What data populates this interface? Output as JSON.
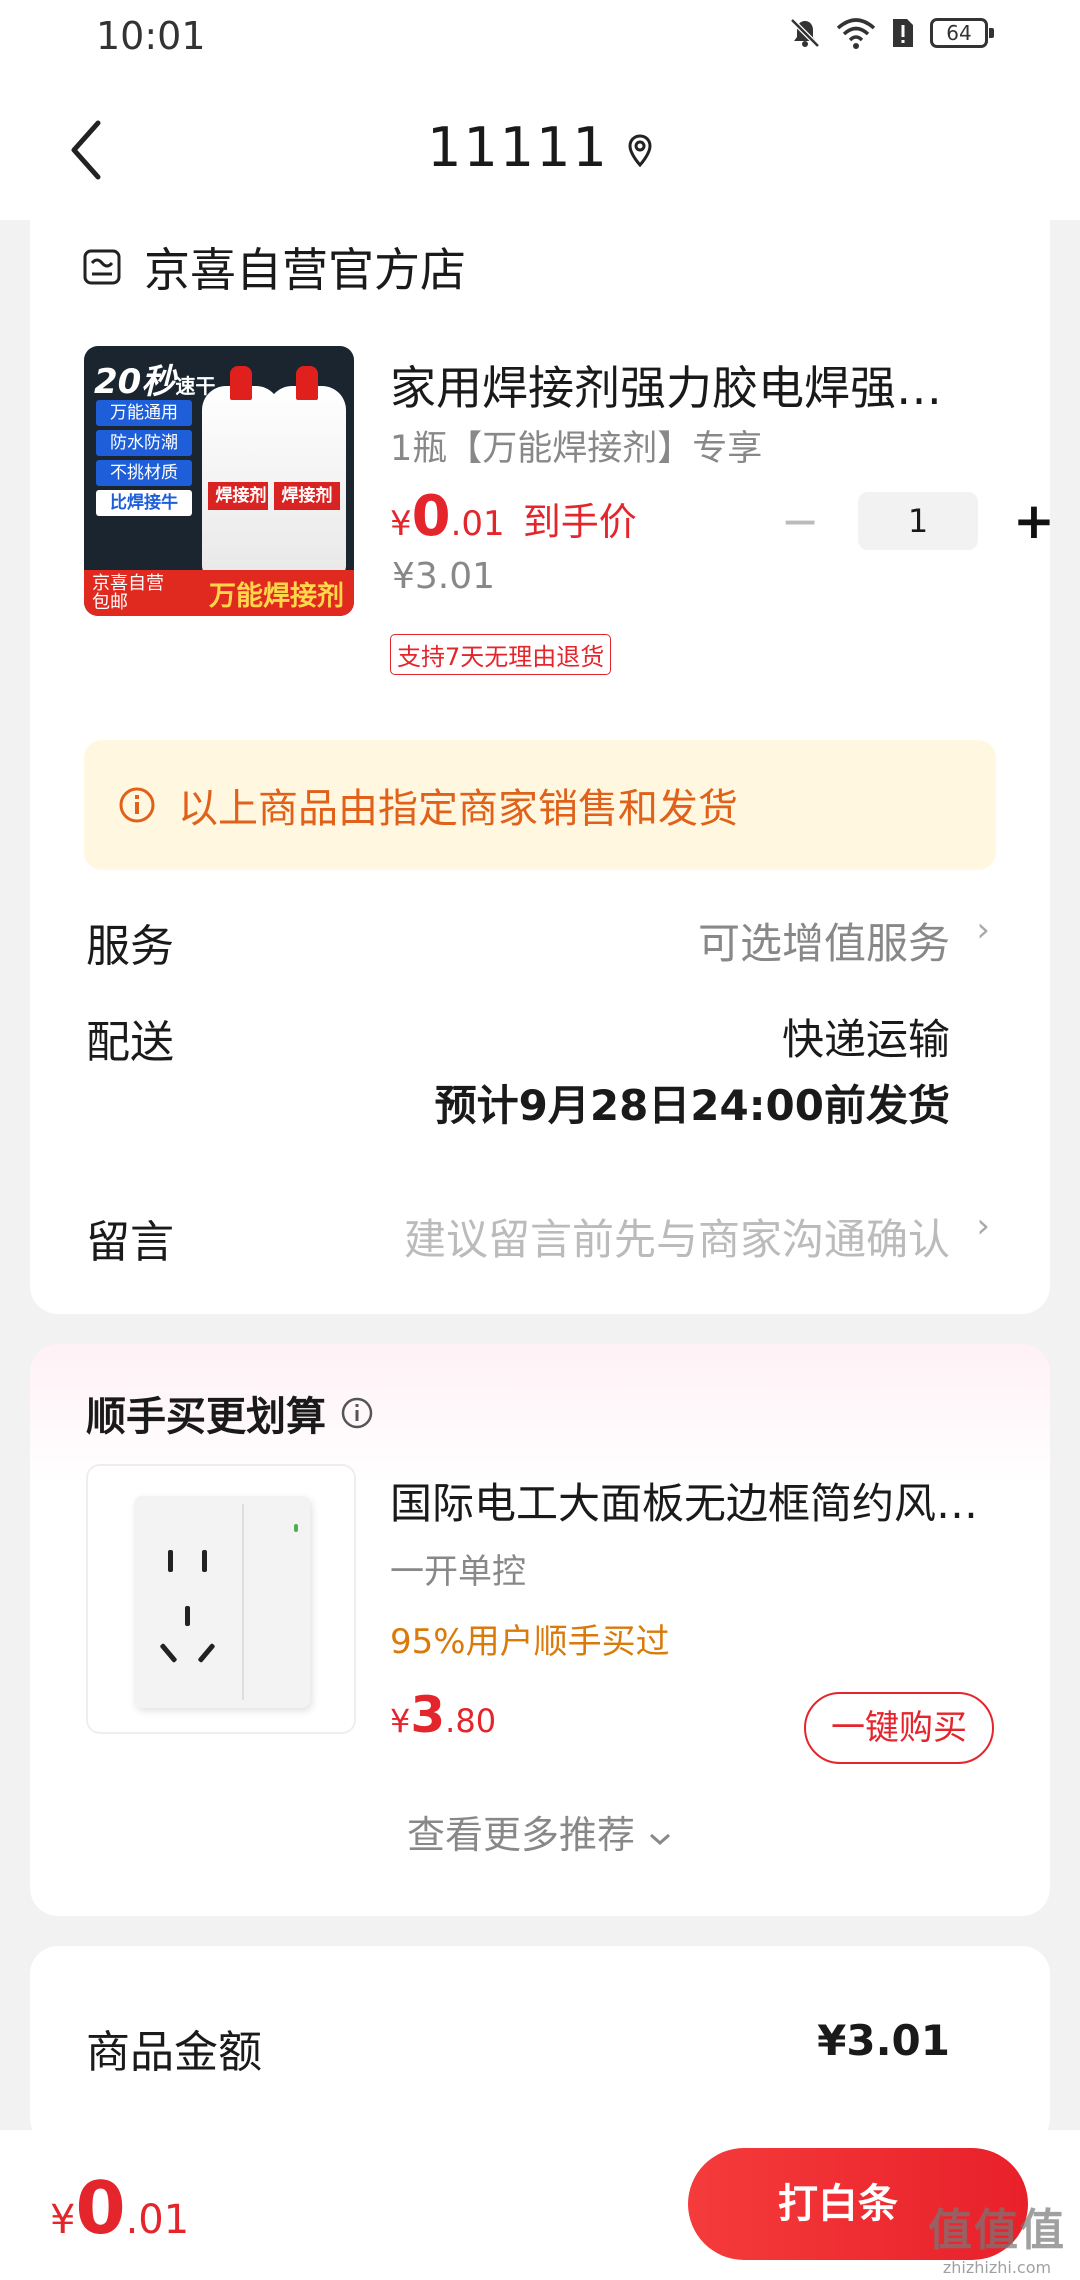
{
  "status_bar": {
    "time": "10:01",
    "battery": "64"
  },
  "nav": {
    "title": "11111"
  },
  "store": {
    "name": "京喜自营官方店"
  },
  "product": {
    "title": "家用焊接剂强力胶电焊强…",
    "spec": "1瓶【万能焊接剂】专享",
    "price_symbol": "¥",
    "price_int": "0",
    "price_dec": ".01",
    "price_label": "到手价",
    "orig_price": "¥3.01",
    "return_tag": "支持7天无理由退货",
    "quantity": "1",
    "image_text": {
      "top": "20秒",
      "top_small": "速干",
      "tags": [
        "万能通用",
        "防水防潮",
        "不挑材质",
        "比焊接牛"
      ],
      "bottle_label": "焊接剂",
      "foot_left": "京喜自营",
      "foot_left2": "包邮",
      "foot_right": "万能焊接剂"
    }
  },
  "notice": {
    "text": "以上商品由指定商家销售和发货"
  },
  "service": {
    "label": "服务",
    "value": "可选增值服务"
  },
  "delivery": {
    "label": "配送",
    "method": "快递运输",
    "eta": "预计9月28日24:00前发货"
  },
  "message": {
    "label": "留言",
    "placeholder": "建议留言前先与商家沟通确认"
  },
  "recommend": {
    "title": "顺手买更划算",
    "item": {
      "name": "国际电工大面板无边框简约风…",
      "spec": "一开单控",
      "hint": "95%用户顺手买过",
      "price_symbol": "¥",
      "price_int": "3",
      "price_dec": ".80",
      "buy_label": "一键购买"
    },
    "more_label": "查看更多推荐"
  },
  "summary": {
    "label": "商品金额",
    "value": "¥3.01"
  },
  "bottom": {
    "total_symbol": "¥",
    "total_int": "0",
    "total_dec": ".01",
    "pay_label": "打白条",
    "watermark": "值值值",
    "watermark_url": "zhizhizhi.com"
  },
  "colors": {
    "accent": "#e4252c",
    "notice_bg": "#fff7e0",
    "notice_text": "#e0611a",
    "hint": "#d97a0a"
  }
}
